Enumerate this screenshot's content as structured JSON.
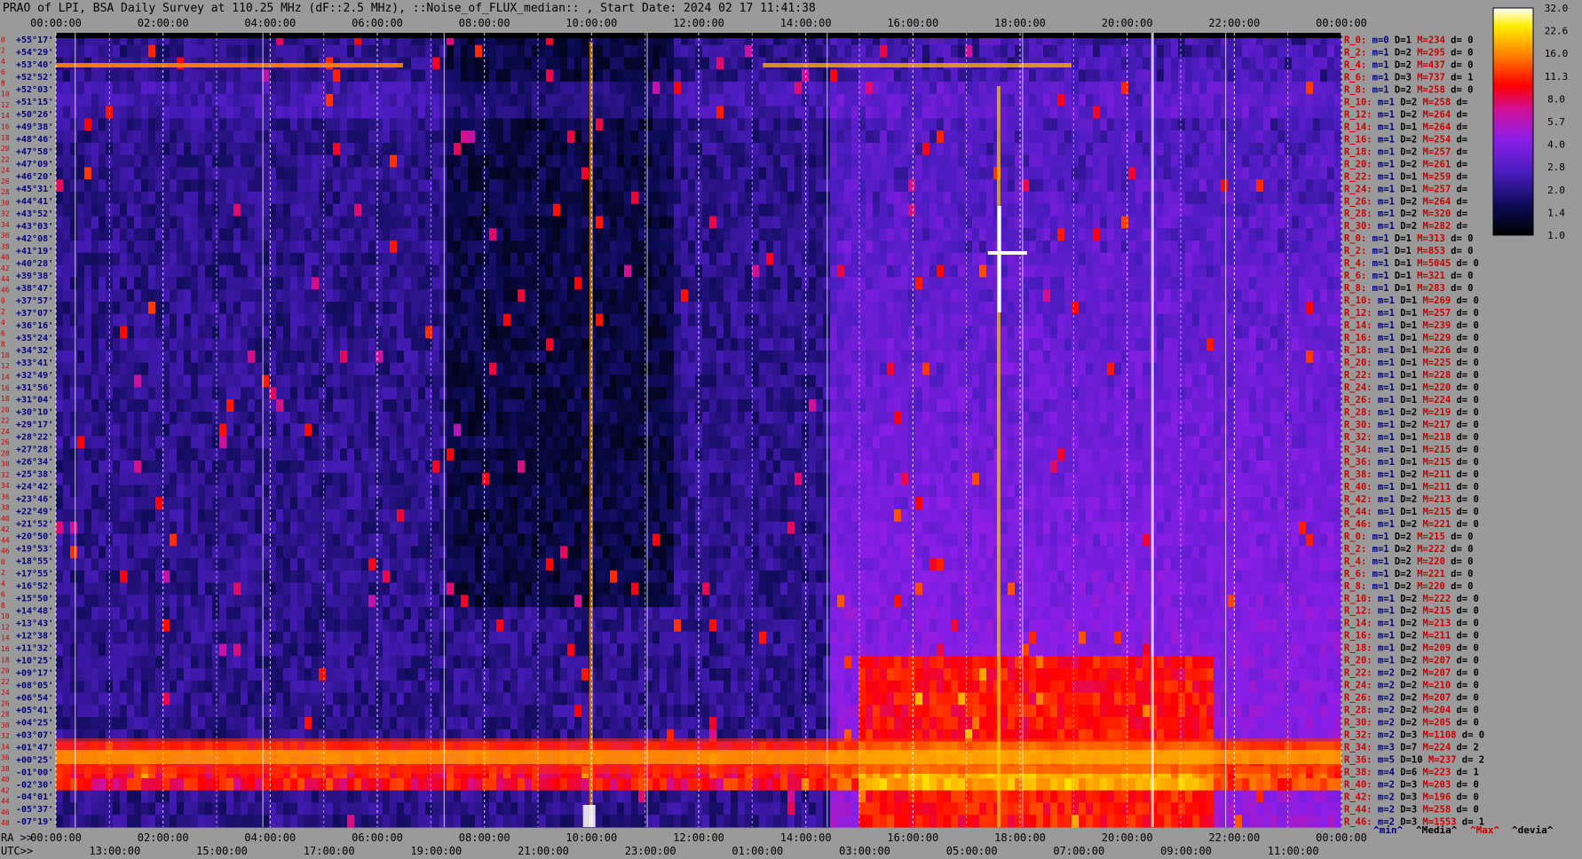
{
  "title": "PRAO of LPI, BSA Daily Survey at 110.25 MHz (dF::2.5 MHz), ::Noise_of_FLUX_median:: , Start Date: 2024 02 17 11:41:38",
  "colors": {
    "background": "#9a9a9a",
    "stat_label": "#cc0000",
    "stat_value": "#000080"
  },
  "chart_data": {
    "type": "heatmap",
    "top_axis_labels": [
      "00:00:00",
      "02:00:00",
      "04:00:00",
      "06:00:00",
      "08:00:00",
      "10:00:00",
      "12:00:00",
      "14:00:00",
      "16:00:00",
      "18:00:00",
      "20:00:00",
      "22:00:00",
      "00:00:00"
    ],
    "bottom_axis": {
      "ra_prefix": "RA >>",
      "ra_labels": [
        "00:00:00",
        "02:00:00",
        "04:00:00",
        "06:00:00",
        "08:00:00",
        "10:00:00",
        "12:00:00",
        "14:00:00",
        "16:00:00",
        "18:00:00",
        "20:00:00",
        "22:00:00",
        "00:00:00"
      ],
      "utc_prefix": "UTC>>",
      "utc_labels": [
        "13:00:00",
        "15:00:00",
        "17:00:00",
        "19:00:00",
        "21:00:00",
        "23:00:00",
        "01:00:00",
        "03:00:00",
        "05:00:00",
        "07:00:00",
        "09:00:00",
        "11:00:00"
      ]
    },
    "row_index": [
      "0",
      "2",
      "4",
      "6",
      "8",
      "10",
      "12",
      "14",
      "16",
      "18",
      "20",
      "22",
      "24",
      "26",
      "28",
      "30",
      "32",
      "34",
      "36",
      "38",
      "40",
      "42",
      "44",
      "46",
      "0",
      "2",
      "4",
      "6",
      "8",
      "10",
      "12",
      "14",
      "16",
      "18",
      "20",
      "22",
      "24",
      "26",
      "28",
      "30",
      "32",
      "34",
      "36",
      "38",
      "40",
      "42",
      "44",
      "46",
      "0",
      "2",
      "4",
      "6",
      "8",
      "10",
      "12",
      "14",
      "16",
      "18",
      "20",
      "22",
      "24",
      "26",
      "28",
      "30",
      "32",
      "34",
      "36",
      "38",
      "40",
      "42",
      "44",
      "46",
      "48"
    ],
    "declination_labels": [
      "+55°17'",
      "+54°29'",
      "+53°40'",
      "+52°52'",
      "+52°03'",
      "+51°15'",
      "+50°26'",
      "+49°38'",
      "+48°46'",
      "+47°58'",
      "+47°09'",
      "+46°20'",
      "+45°31'",
      "+44°41'",
      "+43°52'",
      "+43°03'",
      "+42°08'",
      "+41°19'",
      "+40°28'",
      "+39°38'",
      "+38°47'",
      "+37°57'",
      "+37°07'",
      "+36°16'",
      "+35°24'",
      "+34°32'",
      "+33°41'",
      "+32°49'",
      "+31°56'",
      "+31°04'",
      "+30°10'",
      "+29°17'",
      "+28°22'",
      "+27°28'",
      "+26°34'",
      "+25°38'",
      "+24°42'",
      "+23°46'",
      "+22°49'",
      "+21°52'",
      "+20°50'",
      "+19°53'",
      "+18°55'",
      "+17°55'",
      "+16°52'",
      "+15°50'",
      "+14°48'",
      "+13°43'",
      "+12°38'",
      "+11°32'",
      "+10°25'",
      "+09°17'",
      "+08°05'",
      "+06°54'",
      "+05°41'",
      "+04°25'",
      "+03°07'",
      "+01°47'",
      "+00°25'",
      "-01°00'",
      "-02°30'",
      "-04°01'",
      "-05°37'",
      "-07°19'"
    ],
    "colorbar": {
      "ticks": [
        "32.0",
        "22.6",
        "16.0",
        "11.3",
        "8.0",
        "5.7",
        "4.0",
        "2.8",
        "2.0",
        "1.4",
        "1.0"
      ],
      "scale": "log",
      "range": [
        1.0,
        32.0
      ]
    },
    "row_stats": [
      {
        "label": "R_0:",
        "m": "0",
        "D": "1",
        "M": "234",
        "d": "0"
      },
      {
        "label": "R_2:",
        "m": "1",
        "D": "2",
        "M": "295",
        "d": "0"
      },
      {
        "label": "R_4:",
        "m": "1",
        "D": "2",
        "M": "437",
        "d": "0"
      },
      {
        "label": "R_6:",
        "m": "1",
        "D": "3",
        "M": "737",
        "d": "1"
      },
      {
        "label": "R_8:",
        "m": "1",
        "D": "2",
        "M": "258",
        "d": "0"
      },
      {
        "label": "R_10:",
        "m": "1",
        "D": "2",
        "M": "258",
        "d": ""
      },
      {
        "label": "R_12:",
        "m": "1",
        "D": "2",
        "M": "264",
        "d": ""
      },
      {
        "label": "R_14:",
        "m": "1",
        "D": "1",
        "M": "264",
        "d": ""
      },
      {
        "label": "R_16:",
        "m": "1",
        "D": "2",
        "M": "254",
        "d": ""
      },
      {
        "label": "R_18:",
        "m": "1",
        "D": "2",
        "M": "257",
        "d": ""
      },
      {
        "label": "R_20:",
        "m": "1",
        "D": "2",
        "M": "261",
        "d": ""
      },
      {
        "label": "R_22:",
        "m": "1",
        "D": "1",
        "M": "259",
        "d": ""
      },
      {
        "label": "R_24:",
        "m": "1",
        "D": "1",
        "M": "257",
        "d": ""
      },
      {
        "label": "R_26:",
        "m": "1",
        "D": "2",
        "M": "264",
        "d": ""
      },
      {
        "label": "R_28:",
        "m": "1",
        "D": "2",
        "M": "320",
        "d": ""
      },
      {
        "label": "R_30:",
        "m": "1",
        "D": "2",
        "M": "282",
        "d": ""
      },
      {
        "label": "R_0:",
        "m": "1",
        "D": "1",
        "M": "313",
        "d": "0"
      },
      {
        "label": "R_2:",
        "m": "1",
        "D": "1",
        "M": "853",
        "d": "0"
      },
      {
        "label": "R_4:",
        "m": "1",
        "D": "1",
        "M": "5045",
        "d": "0"
      },
      {
        "label": "R_6:",
        "m": "1",
        "D": "1",
        "M": "321",
        "d": "0"
      },
      {
        "label": "R_8:",
        "m": "1",
        "D": "1",
        "M": "283",
        "d": "0"
      },
      {
        "label": "R_10:",
        "m": "1",
        "D": "1",
        "M": "269",
        "d": "0"
      },
      {
        "label": "R_12:",
        "m": "1",
        "D": "1",
        "M": "257",
        "d": "0"
      },
      {
        "label": "R_14:",
        "m": "1",
        "D": "1",
        "M": "239",
        "d": "0"
      },
      {
        "label": "R_16:",
        "m": "1",
        "D": "1",
        "M": "229",
        "d": "0"
      },
      {
        "label": "R_18:",
        "m": "1",
        "D": "1",
        "M": "226",
        "d": "0"
      },
      {
        "label": "R_20:",
        "m": "1",
        "D": "1",
        "M": "225",
        "d": "0"
      },
      {
        "label": "R_22:",
        "m": "1",
        "D": "1",
        "M": "228",
        "d": "0"
      },
      {
        "label": "R_24:",
        "m": "1",
        "D": "1",
        "M": "220",
        "d": "0"
      },
      {
        "label": "R_26:",
        "m": "1",
        "D": "1",
        "M": "224",
        "d": "0"
      },
      {
        "label": "R_28:",
        "m": "1",
        "D": "2",
        "M": "219",
        "d": "0"
      },
      {
        "label": "R_30:",
        "m": "1",
        "D": "2",
        "M": "217",
        "d": "0"
      },
      {
        "label": "R_32:",
        "m": "1",
        "D": "1",
        "M": "218",
        "d": "0"
      },
      {
        "label": "R_34:",
        "m": "1",
        "D": "1",
        "M": "215",
        "d": "0"
      },
      {
        "label": "R_36:",
        "m": "1",
        "D": "1",
        "M": "215",
        "d": "0"
      },
      {
        "label": "R_38:",
        "m": "1",
        "D": "2",
        "M": "211",
        "d": "0"
      },
      {
        "label": "R_40:",
        "m": "1",
        "D": "1",
        "M": "211",
        "d": "0"
      },
      {
        "label": "R_42:",
        "m": "1",
        "D": "2",
        "M": "213",
        "d": "0"
      },
      {
        "label": "R_44:",
        "m": "1",
        "D": "1",
        "M": "215",
        "d": "0"
      },
      {
        "label": "R_46:",
        "m": "1",
        "D": "2",
        "M": "221",
        "d": "0"
      },
      {
        "label": "R_0:",
        "m": "1",
        "D": "2",
        "M": "215",
        "d": "0"
      },
      {
        "label": "R_2:",
        "m": "1",
        "D": "2",
        "M": "222",
        "d": "0"
      },
      {
        "label": "R_4:",
        "m": "1",
        "D": "2",
        "M": "220",
        "d": "0"
      },
      {
        "label": "R_6:",
        "m": "1",
        "D": "2",
        "M": "221",
        "d": "0"
      },
      {
        "label": "R_8:",
        "m": "1",
        "D": "2",
        "M": "220",
        "d": "0"
      },
      {
        "label": "R_10:",
        "m": "1",
        "D": "2",
        "M": "222",
        "d": "0"
      },
      {
        "label": "R_12:",
        "m": "1",
        "D": "2",
        "M": "215",
        "d": "0"
      },
      {
        "label": "R_14:",
        "m": "1",
        "D": "2",
        "M": "213",
        "d": "0"
      },
      {
        "label": "R_16:",
        "m": "1",
        "D": "2",
        "M": "211",
        "d": "0"
      },
      {
        "label": "R_18:",
        "m": "1",
        "D": "2",
        "M": "209",
        "d": "0"
      },
      {
        "label": "R_20:",
        "m": "1",
        "D": "2",
        "M": "207",
        "d": "0"
      },
      {
        "label": "R_22:",
        "m": "2",
        "D": "2",
        "M": "207",
        "d": "0"
      },
      {
        "label": "R_24:",
        "m": "2",
        "D": "2",
        "M": "210",
        "d": "0"
      },
      {
        "label": "R_26:",
        "m": "2",
        "D": "2",
        "M": "207",
        "d": "0"
      },
      {
        "label": "R_28:",
        "m": "2",
        "D": "2",
        "M": "204",
        "d": "0"
      },
      {
        "label": "R_30:",
        "m": "2",
        "D": "2",
        "M": "205",
        "d": "0"
      },
      {
        "label": "R_32:",
        "m": "2",
        "D": "3",
        "M": "1108",
        "d": "0"
      },
      {
        "label": "R_34:",
        "m": "3",
        "D": "7",
        "M": "224",
        "d": "2"
      },
      {
        "label": "R_36:",
        "m": "5",
        "D": "10",
        "M": "237",
        "d": "2"
      },
      {
        "label": "R_38:",
        "m": "4",
        "D": "6",
        "M": "223",
        "d": "1"
      },
      {
        "label": "R_40:",
        "m": "2",
        "D": "3",
        "M": "203",
        "d": "0"
      },
      {
        "label": "R_42:",
        "m": "2",
        "D": "3",
        "M": "196",
        "d": "0"
      },
      {
        "label": "R_44:",
        "m": "2",
        "D": "3",
        "M": "258",
        "d": "0"
      },
      {
        "label": "R_46:",
        "m": "2",
        "D": "3",
        "M": "1553",
        "d": "1"
      }
    ],
    "legend_keys": [
      "^min^",
      "^Media^",
      "^Max^",
      "^devia^"
    ],
    "legend_colors": [
      "#000080",
      "#000000",
      "#cc0000",
      "#000000"
    ]
  }
}
